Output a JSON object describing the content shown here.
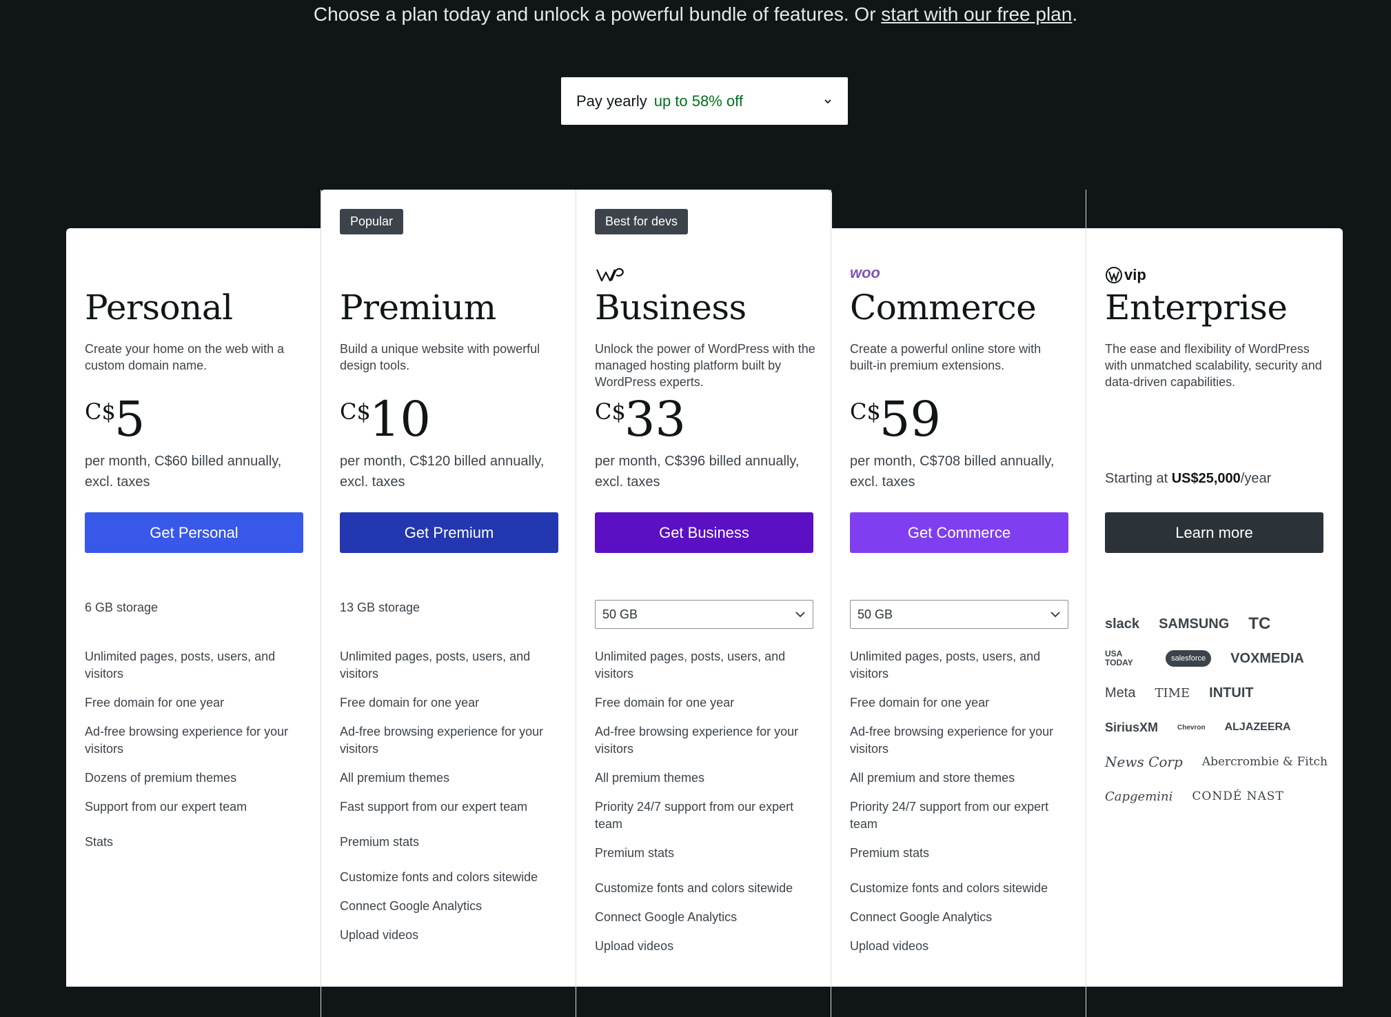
{
  "header": {
    "subtitle_pre": "Choose a plan today and unlock a powerful bundle of features. Or ",
    "subtitle_link": "start with our free plan",
    "subtitle_post": "."
  },
  "billing": {
    "label": "Pay yearly",
    "discount": "up to 58% off"
  },
  "plans": [
    {
      "name": "Personal",
      "description": "Create your home on the web with a custom domain name.",
      "currency": "C$",
      "price": "5",
      "billed": "per month, C$60 billed annually, excl. taxes",
      "cta": "Get Personal",
      "cta_color": "#3858e9",
      "storage": "6 GB storage",
      "features": [
        "Unlimited pages, posts, users, and visitors",
        "Free domain for one year",
        "Ad-free browsing experience for your visitors",
        "Dozens of premium themes",
        "Support from our expert team",
        "Stats"
      ]
    },
    {
      "name": "Premium",
      "badge": "Popular",
      "description": "Build a unique website with powerful design tools.",
      "currency": "C$",
      "price": "10",
      "billed": "per month, C$120 billed annually, excl. taxes",
      "cta": "Get Premium",
      "cta_color": "#2337b0",
      "storage": "13 GB storage",
      "features": [
        "Unlimited pages, posts, users, and visitors",
        "Free domain for one year",
        "Ad-free browsing experience for your visitors",
        "All premium themes",
        "Fast support from our expert team",
        "Premium stats",
        "Customize fonts and colors sitewide",
        "Connect Google Analytics",
        "Upload videos"
      ]
    },
    {
      "name": "Business",
      "badge": "Best for devs",
      "description": "Unlock the power of WordPress with the managed hosting platform built by WordPress experts.",
      "currency": "C$",
      "price": "33",
      "billed": "per month, C$396 billed annually, excl. taxes",
      "cta": "Get Business",
      "cta_color": "#5b10c4",
      "storage": "50 GB",
      "features": [
        "Unlimited pages, posts, users, and visitors",
        "Free domain for one year",
        "Ad-free browsing experience for your visitors",
        "All premium themes",
        "Priority 24/7 support from our expert team",
        "Premium stats",
        "Customize fonts and colors sitewide",
        "Connect Google Analytics",
        "Upload videos"
      ]
    },
    {
      "name": "Commerce",
      "logo": "woo",
      "description": "Create a powerful online store with built-in premium extensions.",
      "currency": "C$",
      "price": "59",
      "billed": "per month, C$708 billed annually, excl. taxes",
      "cta": "Get Commerce",
      "cta_color": "#7f3ff0",
      "storage": "50 GB",
      "features": [
        "Unlimited pages, posts, users, and visitors",
        "Free domain for one year",
        "Ad-free browsing experience for your visitors",
        "All premium and store themes",
        "Priority 24/7 support from our expert team",
        "Premium stats",
        "Customize fonts and colors sitewide",
        "Connect Google Analytics",
        "Upload videos"
      ]
    },
    {
      "name": "Enterprise",
      "logo": "vip",
      "description": "The ease and flexibility of WordPress with unmatched scalability, security and data-driven capabilities.",
      "starting_pre": "Starting at ",
      "starting_price": "US$25,000",
      "starting_post": "/year",
      "cta": "Learn more",
      "cta_color": "#2c3338",
      "customers": [
        "slack",
        "SAMSUNG",
        "TC",
        "USA TODAY",
        "salesforce",
        "VOXMEDIA",
        "Meta",
        "TIME",
        "INTUIT",
        "SiriusXM",
        "Chevron",
        "ALJAZEERA",
        "News Corp",
        "Abercrombie & Fitch",
        "Capgemini",
        "CONDÉ NAST"
      ]
    }
  ]
}
